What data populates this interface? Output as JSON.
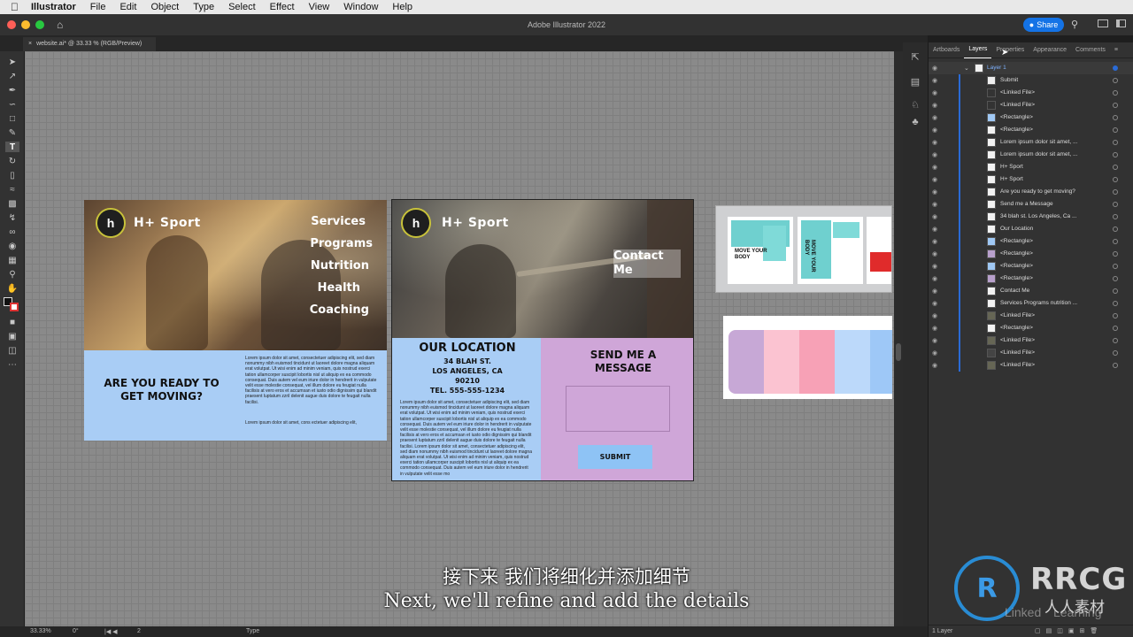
{
  "menubar": {
    "app": "Illustrator",
    "items": [
      "File",
      "Edit",
      "Object",
      "Type",
      "Select",
      "Effect",
      "View",
      "Window",
      "Help"
    ]
  },
  "titlebar": {
    "title": "Adobe Illustrator 2022",
    "share_label": "Share"
  },
  "document_tab": {
    "label": "website.ai* @ 33.33 % (RGB/Preview)"
  },
  "artboard1": {
    "logo_letter": "h",
    "brand": "H+ Sport",
    "menu": [
      "Services",
      "Programs",
      "Nutrition",
      "Health",
      "Coaching"
    ],
    "headline": "Are you ready to get moving?",
    "body": "Lorem ipsum dolor sit amet, consectetuer adipiscing elit, sed diam nonummy nibh euismod tincidunt ut laoreet dolore magna aliquam erat volutpat. Ut wisi enim ad minim veniam, quis nostrud exerci tation ullamcorper suscipit lobortis nisl ut aliquip ex ea commodo consequat. Duis autem vel eum iriure dolor in hendrerit in vulputate velit esse molestie consequat, vel illum dolore eu feugiat nulla facilisis at vero eros et accumsan et iusto odio dignissim qui blandit praesent luptatum zzril delenit augue duis dolore te feugait nulla facilisi.",
    "body2": "Lorem ipsum dolor sit amet, cons ectetuer adipiscing elit,"
  },
  "artboard2": {
    "logo_letter": "h",
    "brand": "H+ Sport",
    "contact": "Contact Me",
    "location_title": "Our Location",
    "address1": "34 Blah St.",
    "address2": "Los Angeles, CA",
    "zip": "90210",
    "tel": "Tel. 555-555-1234",
    "body": "Lorem ipsum dolor sit amet, consectetuer adipiscing elit, sed diam nonummy nibh euismod tincidunt ut laoreet dolore magna aliquam erat volutpat. Ut wisi enim ad minim veniam, quis nostrud exerci tation ullamcorper suscipit lobortis nisl ut aliquip ex ea commodo consequat. Duis autem vel eum iriure dolor in hendrerit in vulputate velit esse molestie consequat, vel illum dolore eu feugiat nulla facilisis at vero eros et accumsan et iusto odio dignissim qui blandit praesent luptatum zzril delenit augue duis dolore te feugait nulla facilisi. Lorem ipsum dolor sit amet, consectetuer adipiscing elit, sed diam nonummy nibh euismod tincidunt ut laoreet dolore magna aliquam erat volutpat. Ut wisi enim ad minim veniam, quis nostrud exerci tation ullamcorper suscipit lobortis nisl ut aliquip ex ea commodo consequat. Duis autem vel eum iriure dolor in hendrerit in vulputate velit esse mo",
    "message_title": "Send me a Message",
    "submit": "Submit"
  },
  "moodboard": {
    "card1_title": "Move your body",
    "card2_title": "Move your body"
  },
  "palette": {
    "colors": [
      "#c7a8d6",
      "#fbc3d1",
      "#f7a1b6",
      "#bcd9fa",
      "#9ec8f7"
    ]
  },
  "panel": {
    "tabs": [
      "Artboards",
      "Layers",
      "Properties",
      "Appearance",
      "Comments"
    ],
    "active_tab": "Layers",
    "layer_name": "Layer 1",
    "sublayers": [
      "Submit",
      "<Linked File>",
      "<Linked File>",
      "<Rectangle>",
      "<Rectangle>",
      "Lorem ipsum dolor sit amet, ...",
      "Lorem ipsum dolor sit amet, ...",
      "H+ Sport",
      "H+ Sport",
      "Are you ready to  get moving?",
      "Send me a Message",
      "34 blah st. Los Angeles, Ca ...",
      "Our Location",
      "<Rectangle>",
      "<Rectangle>",
      "<Rectangle>",
      "<Rectangle>",
      "Contact Me",
      "Services Programs nutrition ...",
      "<Linked File>",
      "<Rectangle>",
      "<Linked File>",
      "<Linked File>",
      "<Linked File>"
    ],
    "footer": "1 Layer"
  },
  "statusbar": {
    "zoom": "33.33%",
    "rotate": "0°",
    "artboard": "2",
    "mode": "Type"
  },
  "subtitles": {
    "zh": "接下来 我们将细化并添加细节",
    "en": "Next, we'll refine and add the details"
  },
  "watermark": {
    "brand": "RRCG",
    "sub": "人人素材",
    "linkedin": "Linked",
    "learning": "Learning"
  },
  "colors": {
    "accent_blue": "#1473e6",
    "light_blue_panel": "#a9cdf5",
    "lavender_panel": "#cfa6d8",
    "submit_blue": "#8ec3f5"
  }
}
